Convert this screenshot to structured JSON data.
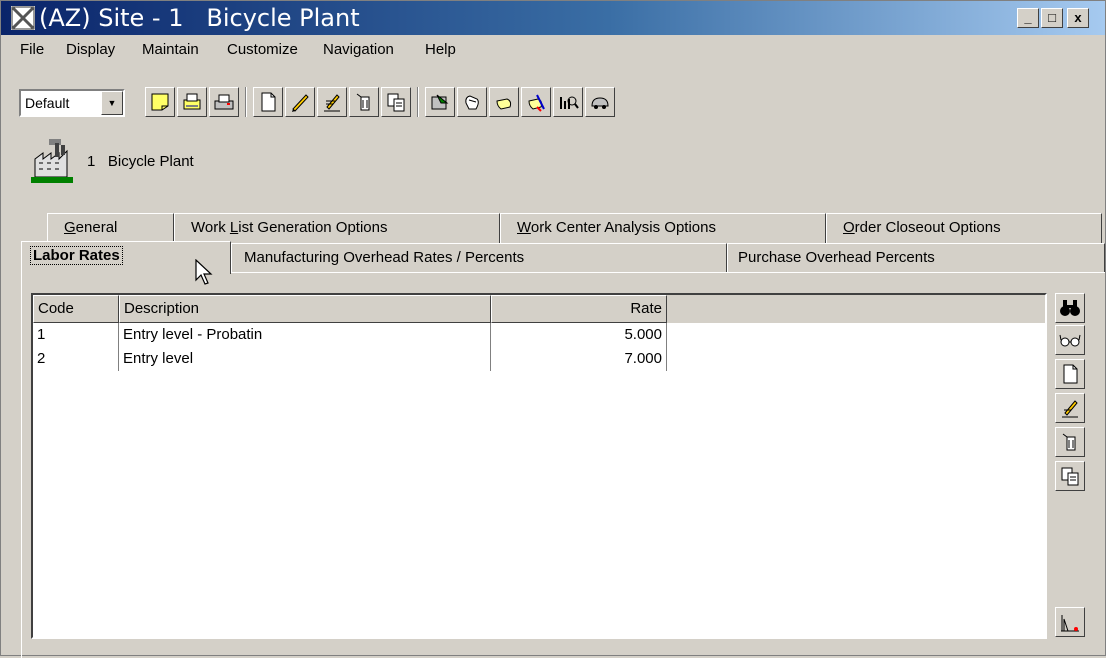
{
  "window": {
    "title": "(AZ) Site - 1   Bicycle Plant",
    "controls": {
      "minimize": "_",
      "maximize": "□",
      "close": "x"
    }
  },
  "menu": [
    "File",
    "Display",
    "Maintain",
    "Customize",
    "Navigation",
    "Help"
  ],
  "toolbar": {
    "view_combo_value": "Default",
    "icons": [
      "note-icon",
      "folder-print-icon",
      "printer-icon",
      "new-document-icon",
      "pencil-icon",
      "edit-pencil-icon",
      "delete-icon",
      "copy-icon",
      "navigate-icon",
      "hand-icon",
      "hand-right-icon",
      "hand-cursor-icon",
      "chart-search-icon",
      "car-icon"
    ]
  },
  "entity": {
    "number": "1",
    "name": "Bicycle Plant"
  },
  "tabs": {
    "back_row": [
      {
        "label": "General",
        "u": "G",
        "rest": "eneral"
      },
      {
        "label": "Work List Generation Options",
        "pre": "Work ",
        "u": "L",
        "rest": "ist Generation Options"
      },
      {
        "label": "Work Center Analysis Options",
        "u": "W",
        "rest": "ork Center Analysis Options"
      },
      {
        "label": "Order Closeout Options",
        "u": "O",
        "rest": "rder Closeout Options"
      }
    ],
    "front_row": [
      {
        "label": "Labor Rates"
      },
      {
        "label": "Manufacturing Overhead Rates / Percents"
      },
      {
        "label": "Purchase Overhead Percents"
      }
    ],
    "active": "Labor Rates"
  },
  "grid": {
    "columns": [
      "Code",
      "Description",
      "Rate"
    ],
    "rows": [
      {
        "code": "1",
        "description": "Entry level - Probatin",
        "rate": "5.000"
      },
      {
        "code": "2",
        "description": "Entry level",
        "rate": "7.000"
      }
    ]
  },
  "side_buttons": [
    "binoculars-icon",
    "glasses-icon",
    "new-document-icon",
    "edit-pencil-icon",
    "delete-icon",
    "copy-icon"
  ],
  "colors": {
    "title_start": "#0a246a",
    "title_end": "#a6caf0",
    "face": "#d4d0c8"
  }
}
